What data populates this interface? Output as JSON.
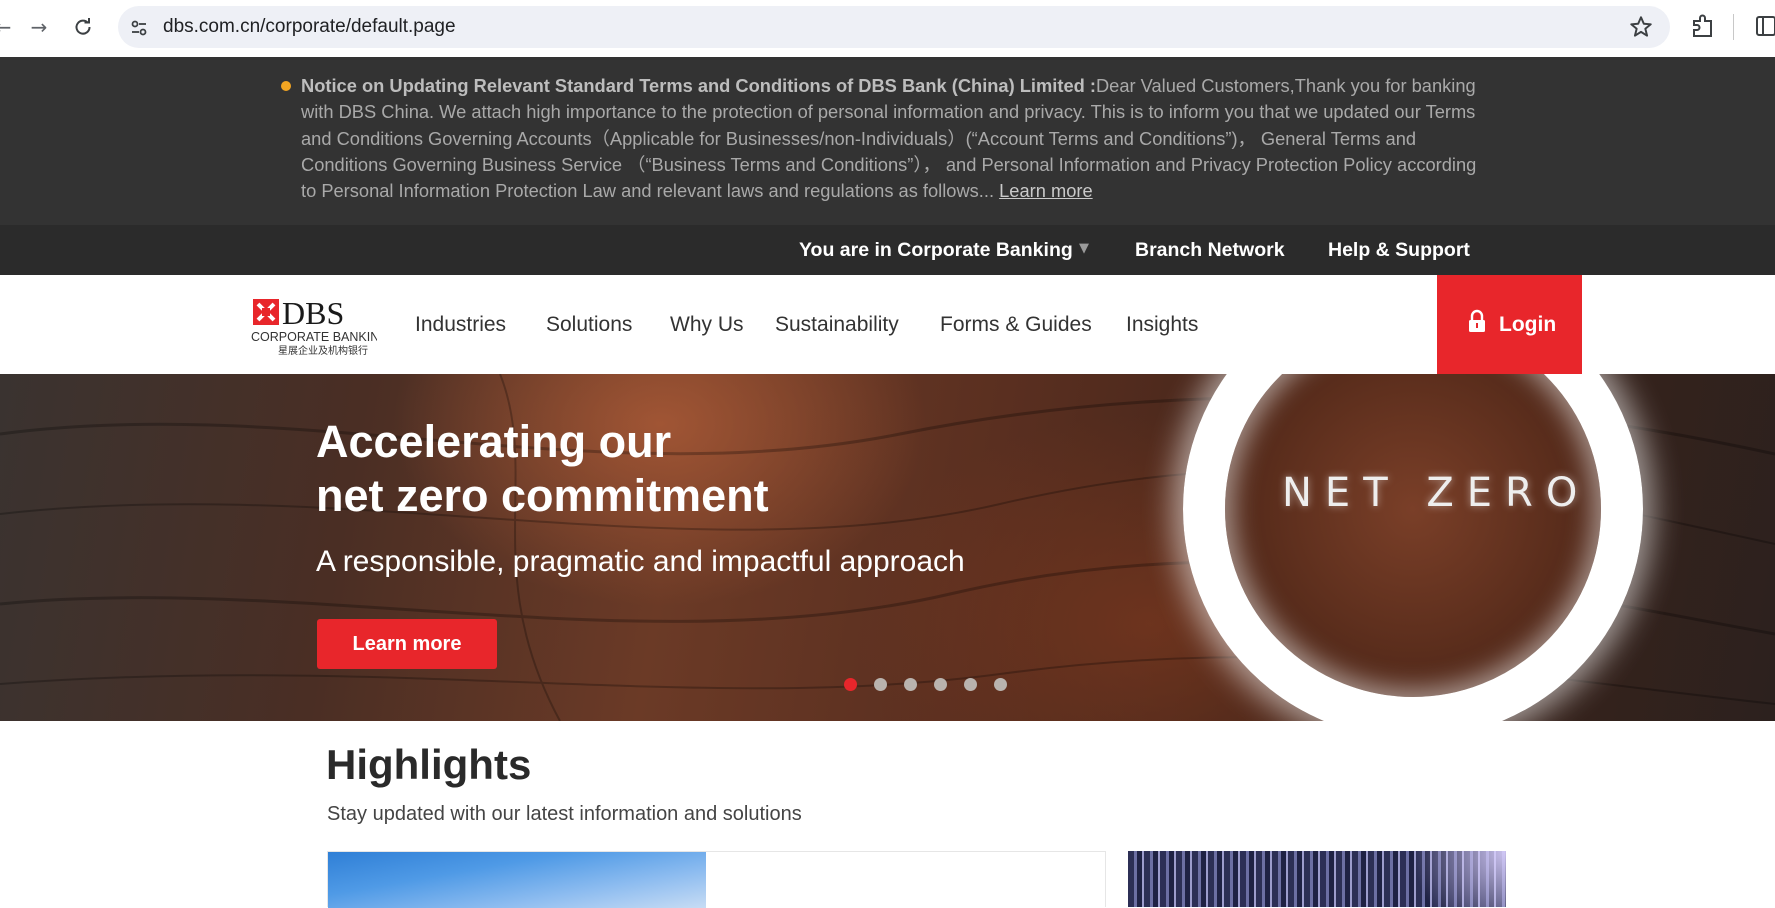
{
  "browser": {
    "url": "dbs.com.cn/corporate/default.page"
  },
  "notice": {
    "heading": "Notice on Updating Relevant Standard Terms and Conditions of DBS Bank (China) Limited :",
    "body": "Dear Valued Customers,Thank you for banking with DBS China. We attach high importance to the protection of personal information and privacy. This is to inform you that we updated our Terms and Conditions Governing Accounts（Applicable for Businesses/non-Individuals）(“Account Terms and Conditions”)， General Terms and Conditions Governing Business Service （“Business Terms and Conditions”）， and Personal Information and Privacy Protection Policy according to Personal Information Protection Law and relevant laws and regulations as follows... ",
    "link": "Learn more"
  },
  "utility_nav": {
    "segment": "You are in Corporate Banking",
    "branch": "Branch Network",
    "help": "Help & Support"
  },
  "logo": {
    "name": "DBS",
    "line1": "CORPORATE BANKING",
    "line2": "星展企业及机构银行"
  },
  "main_nav": {
    "items": [
      "Industries",
      "Solutions",
      "Why Us",
      "Sustainability",
      "Forms & Guides",
      "Insights"
    ],
    "login": "Login"
  },
  "hero": {
    "title_line1": "Accelerating our",
    "title_line2": "net zero commitment",
    "subtitle": "A responsible, pragmatic and impactful approach",
    "button": "Learn more",
    "image_text": "NET ZERO",
    "slide_count": 6,
    "active_slide": 1
  },
  "highlights": {
    "title": "Highlights",
    "subtitle": "Stay updated with our latest information and solutions"
  },
  "colors": {
    "brand_red": "#e8262b",
    "notice_bg": "#333333",
    "notice_dot": "#f4a622"
  }
}
